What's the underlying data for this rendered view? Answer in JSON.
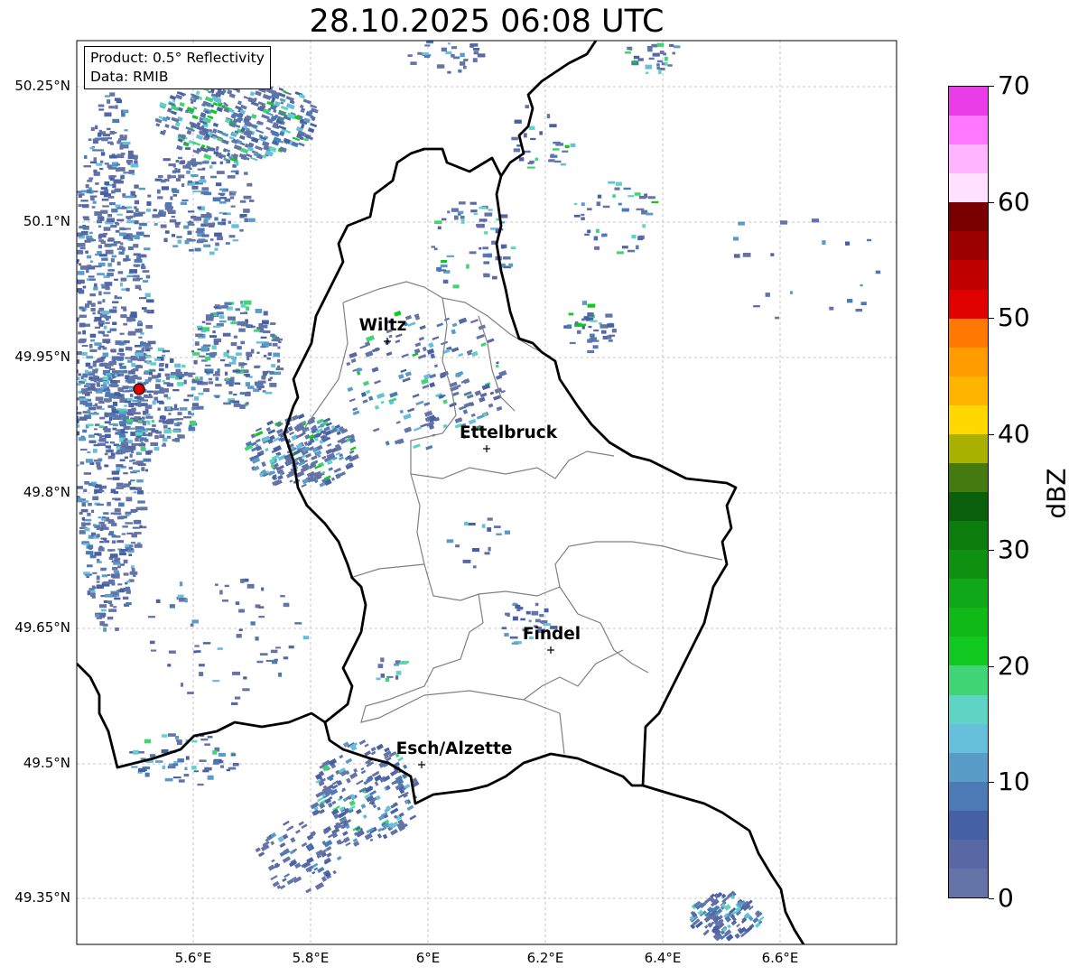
{
  "title": "28.10.2025 06:08 UTC",
  "info_box": {
    "product": "Product: 0.5° Reflectivity",
    "data": "Data: RMIB"
  },
  "latitude_ticks": [
    "50.25°N",
    "50.1°N",
    "49.95°N",
    "49.8°N",
    "49.65°N",
    "49.5°N",
    "49.35°N"
  ],
  "longitude_ticks": [
    "5.6°E",
    "5.8°E",
    "6°E",
    "6.2°E",
    "6.4°E",
    "6.6°E"
  ],
  "cities": [
    {
      "name": "Wiltz"
    },
    {
      "name": "Ettelbruck"
    },
    {
      "name": "Findel"
    },
    {
      "name": "Esch/Alzette"
    }
  ],
  "radar_site": {
    "marker": "red-circle"
  },
  "colorbar": {
    "label": "dBZ",
    "tick_labels": [
      "0",
      "10",
      "20",
      "30",
      "40",
      "50",
      "60",
      "70"
    ],
    "min": 0,
    "max": 70,
    "step": 2.5,
    "colors": [
      "#6474a8",
      "#5868a4",
      "#4660a4",
      "#4c7ab4",
      "#5a9cc8",
      "#66c0dc",
      "#60d4c4",
      "#40d474",
      "#10c820",
      "#10b818",
      "#10a818",
      "#109010",
      "#0c7c0c",
      "#0a600a",
      "#447a10",
      "#a8b000",
      "#ffd800",
      "#ffb400",
      "#ff9c00",
      "#ff7800",
      "#e00000",
      "#c00000",
      "#9c0000",
      "#780000",
      "#ffe0ff",
      "#ffb4ff",
      "#ff78ff",
      "#ea3ce8"
    ]
  }
}
